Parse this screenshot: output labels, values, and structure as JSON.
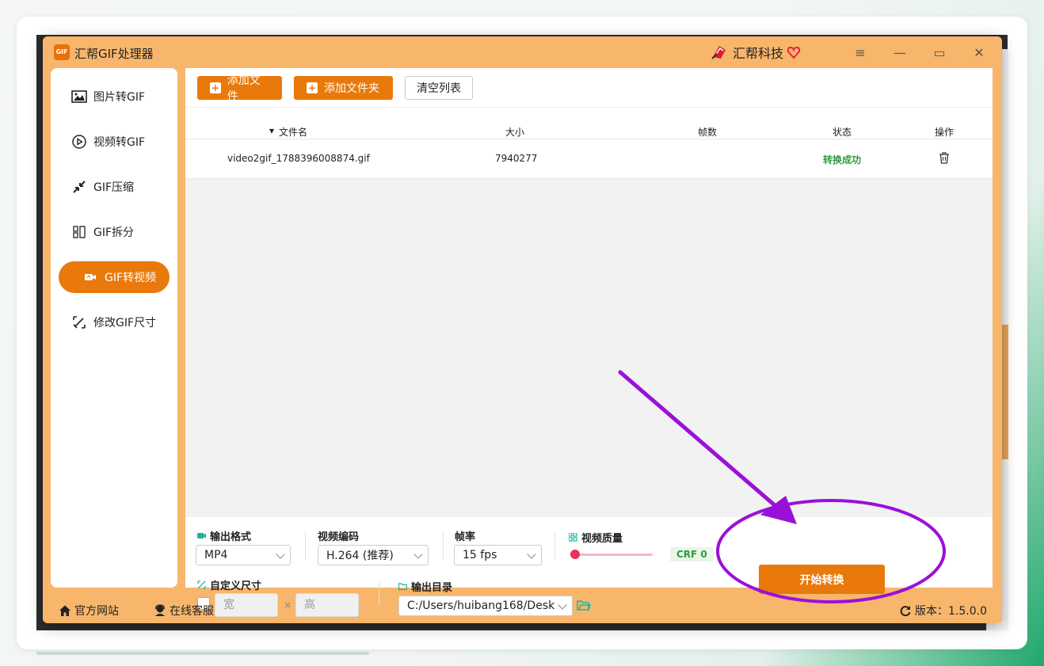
{
  "app": {
    "title": "汇帮GIF处理器",
    "logo_text": "GIF",
    "brand_name": "汇帮科技"
  },
  "window_controls": {
    "menu_icon": "≡",
    "minimize_icon": "—",
    "maximize_icon": "▭",
    "close_icon": "✕"
  },
  "sidebar": {
    "items": [
      {
        "label": "图片转GIF",
        "icon": "image-icon",
        "active": false
      },
      {
        "label": "视频转GIF",
        "icon": "play-icon",
        "active": false
      },
      {
        "label": "GIF压缩",
        "icon": "compress-icon",
        "active": false
      },
      {
        "label": "GIF拆分",
        "icon": "split-icon",
        "active": false
      },
      {
        "label": "GIF转视频",
        "icon": "video-icon",
        "active": true
      },
      {
        "label": "修改GIF尺寸",
        "icon": "resize-icon",
        "active": false
      }
    ]
  },
  "toolbar": {
    "add_file": "添加文件",
    "add_folder": "添加文件夹",
    "clear_list": "清空列表"
  },
  "table": {
    "columns": [
      "文件名",
      "大小",
      "帧数",
      "状态",
      "操作"
    ],
    "sort_marker": "▾",
    "rows": [
      {
        "filename": "video2gif_1788396008874.gif",
        "size": "7940277",
        "frames": "",
        "status": "转换成功",
        "action_icon": "trash-icon"
      }
    ]
  },
  "settings": {
    "output_format": {
      "label": "输出格式",
      "value": "MP4"
    },
    "video_codec": {
      "label": "视频编码",
      "value": "H.264 (推荐)"
    },
    "frame_rate": {
      "label": "帧率",
      "value": "15 fps"
    },
    "video_quality": {
      "label": "视频质量",
      "crf": "CRF 0",
      "level": 0
    },
    "custom_size": {
      "label": "自定义尺寸",
      "checked": false,
      "width_placeholder": "宽",
      "height_placeholder": "高",
      "separator": "×"
    },
    "output_dir": {
      "label": "输出目录",
      "value": "C:/Users/huibang168/Desk"
    }
  },
  "actions": {
    "start": "开始转换"
  },
  "footer": {
    "website": "官方网站",
    "support": "在线客服",
    "version": "版本：1.5.0.0"
  },
  "colors": {
    "accent": "#e8790a",
    "window_bg": "#f7b66b",
    "success": "#2e9d3a",
    "annotation": "#9b10d8"
  }
}
